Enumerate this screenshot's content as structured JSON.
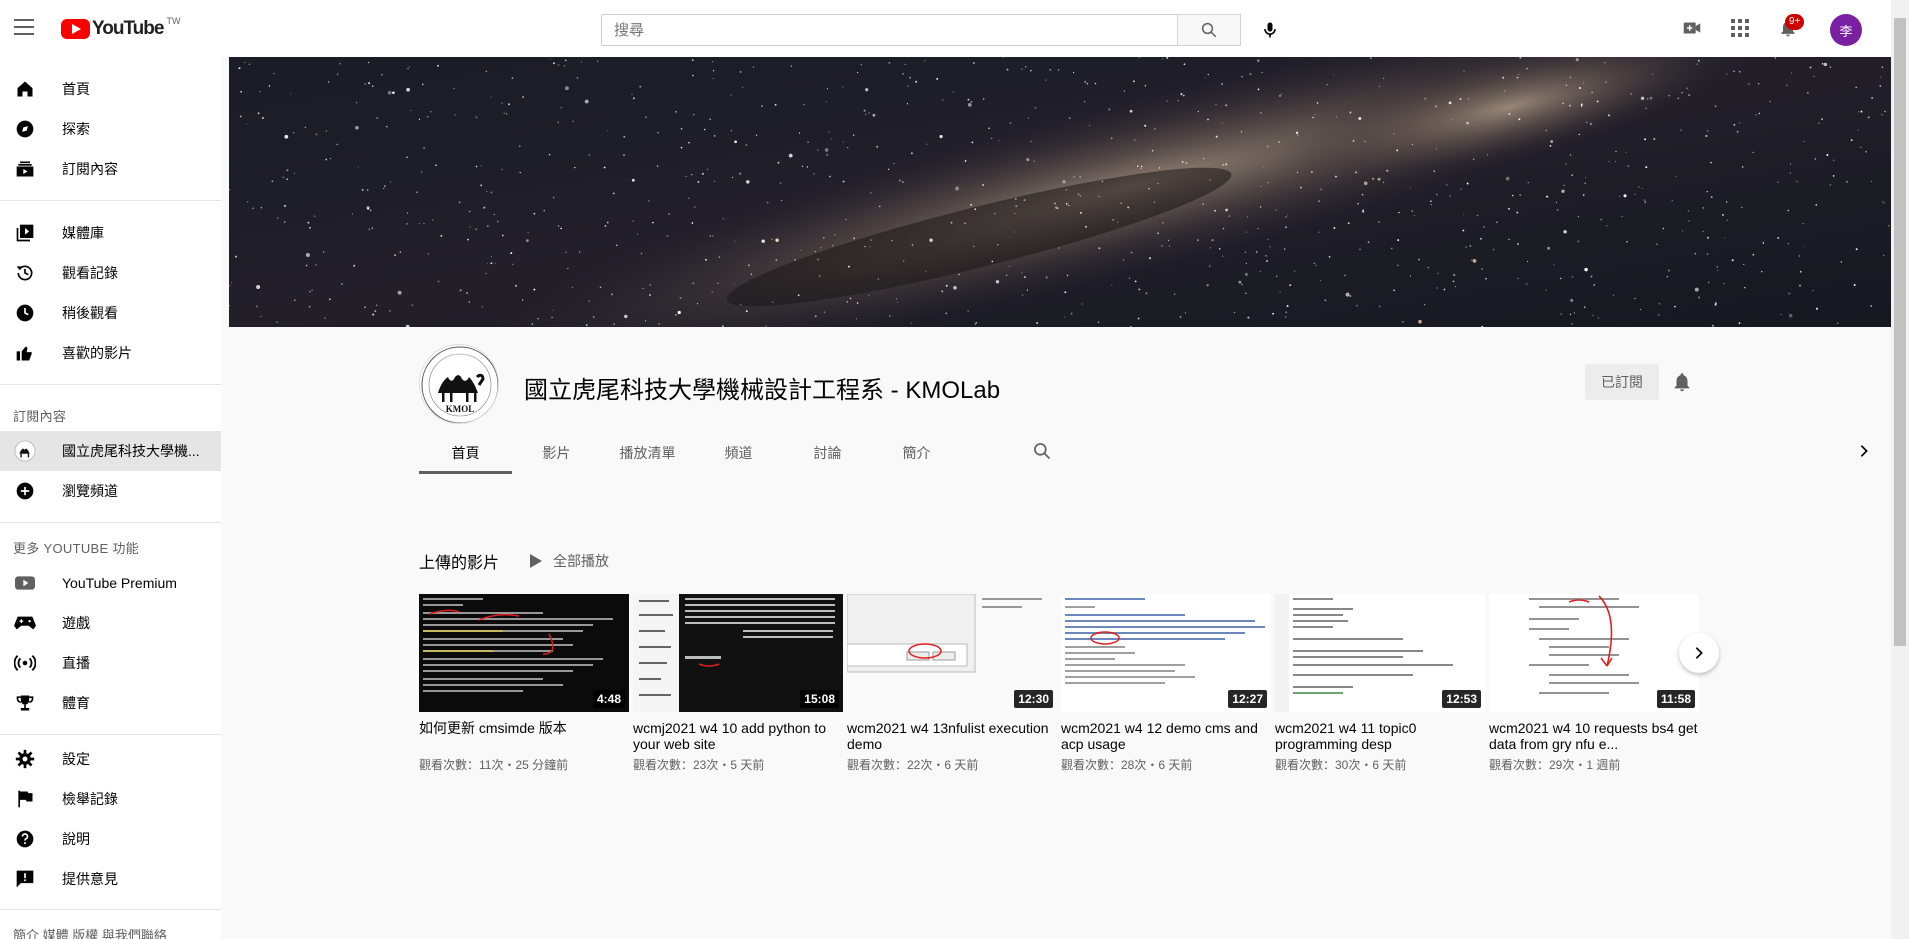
{
  "header": {
    "logo_text": "YouTube",
    "logo_country": "TW",
    "search_placeholder": "搜尋",
    "notification_count": "9+",
    "avatar_letter": "李"
  },
  "sidebar": {
    "primary": [
      {
        "label": "首頁",
        "icon": "home-icon"
      },
      {
        "label": "探索",
        "icon": "compass-icon"
      },
      {
        "label": "訂閱內容",
        "icon": "subscriptions-icon"
      }
    ],
    "library": [
      {
        "label": "媒體庫",
        "icon": "library-icon"
      },
      {
        "label": "觀看記錄",
        "icon": "history-icon"
      },
      {
        "label": "稍後觀看",
        "icon": "clock-icon"
      },
      {
        "label": "喜歡的影片",
        "icon": "thumbs-up-icon"
      }
    ],
    "subscriptions_heading": "訂閱內容",
    "subscriptions": [
      {
        "label": "國立虎尾科技大學機...",
        "icon": "channel-avatar-icon"
      },
      {
        "label": "瀏覽頻道",
        "icon": "plus-circle-icon"
      }
    ],
    "more_heading": "更多 YOUTUBE 功能",
    "more": [
      {
        "label": "YouTube Premium",
        "icon": "youtube-premium-icon"
      },
      {
        "label": "遊戲",
        "icon": "gamepad-icon"
      },
      {
        "label": "直播",
        "icon": "live-icon"
      },
      {
        "label": "體育",
        "icon": "trophy-icon"
      }
    ],
    "settings": [
      {
        "label": "設定",
        "icon": "gear-icon"
      },
      {
        "label": "檢舉記錄",
        "icon": "flag-icon"
      },
      {
        "label": "說明",
        "icon": "help-icon"
      },
      {
        "label": "提供意見",
        "icon": "feedback-icon"
      }
    ],
    "footer": "簡介  媒體  版權  與我們聯絡"
  },
  "channel": {
    "name": "國立虎尾科技大學機械設計工程系 - KMOLab",
    "avatar_text": "KMOL",
    "subscribed_label": "已訂閱",
    "tabs": [
      "首頁",
      "影片",
      "播放清單",
      "頻道",
      "討論",
      "簡介"
    ],
    "active_tab": "首頁"
  },
  "uploads": {
    "title": "上傳的影片",
    "play_all": "全部播放",
    "videos": [
      {
        "title": "如何更新 cmsimde 版本",
        "duration": "4:48",
        "meta": "觀看次數：11次・25 分鐘前"
      },
      {
        "title": "wcmj2021 w4 10 add python to your web site",
        "duration": "15:08",
        "meta": "觀看次數：23次・5 天前"
      },
      {
        "title": "wcm2021 w4 13nfulist execution demo",
        "duration": "12:30",
        "meta": "觀看次數：22次・6 天前"
      },
      {
        "title": "wcm2021 w4 12 demo cms and acp usage",
        "duration": "12:27",
        "meta": "觀看次數：28次・6 天前"
      },
      {
        "title": "wcm2021 w4 11 topic0 programming desp",
        "duration": "12:53",
        "meta": "觀看次數：30次・6 天前"
      },
      {
        "title": "wcm2021 w4 10 requests bs4 get data from gry nfu e...",
        "duration": "11:58",
        "meta": "觀看次數：29次・1 週前"
      }
    ]
  },
  "colors": {
    "brand_red": "#ff0000",
    "avatar_bg": "#7b1fa2",
    "active_bg": "#e5e5e5"
  }
}
